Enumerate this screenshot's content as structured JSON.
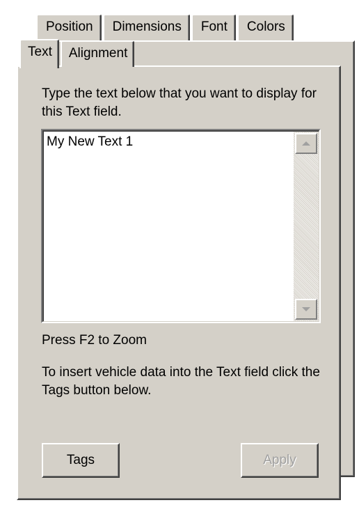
{
  "back_tabs": [
    {
      "label": "Position"
    },
    {
      "label": "Dimensions"
    },
    {
      "label": "Font"
    },
    {
      "label": "Colors"
    }
  ],
  "front_tabs": [
    {
      "label": "Text",
      "active": true
    },
    {
      "label": "Alignment",
      "active": false
    }
  ],
  "text_page": {
    "instructions": "Type the text below that you want to display for this Text field.",
    "text_value": "My New Text 1",
    "zoom_hint": "Press F2 to Zoom",
    "tags_hint": "To insert vehicle data into the Text field click the Tags button below."
  },
  "buttons": {
    "tags_label": "Tags",
    "apply_label": "Apply",
    "apply_enabled": false
  },
  "colors": {
    "face": "#d4d0c8",
    "highlight": "#ffffff",
    "shadow": "#808080",
    "dark_shadow": "#404040",
    "disabled_text": "#a0a0a0"
  },
  "icons": {
    "scroll_up": "arrow-up-icon",
    "scroll_down": "arrow-down-icon"
  }
}
